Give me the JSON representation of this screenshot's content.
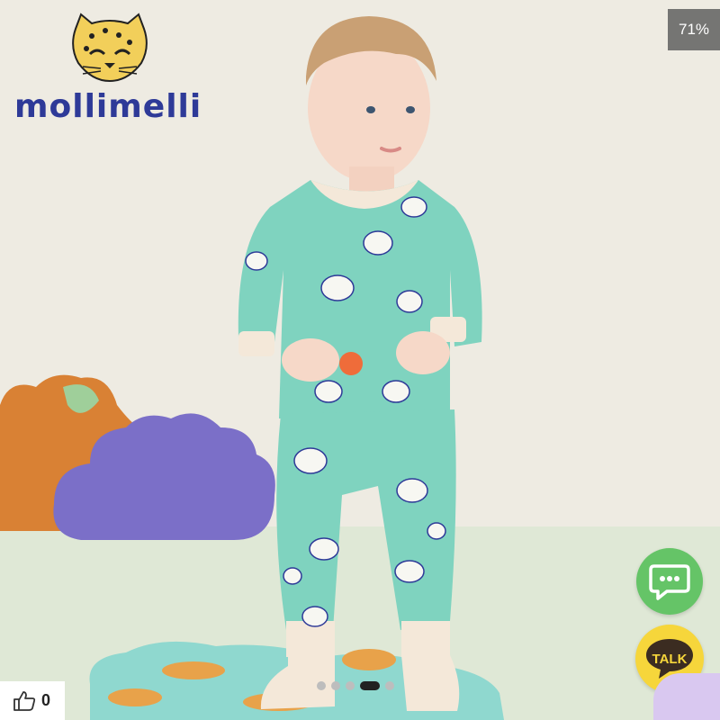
{
  "brand": {
    "name": "mollimelli",
    "logo_icon": "leopard-icon"
  },
  "gallery": {
    "counter": "71%",
    "active_index": 3,
    "dot_count": 5
  },
  "actions": {
    "chat_icon": "chat-bubble-icon",
    "talk_label": "TALK"
  },
  "likes": {
    "count": "0",
    "icon": "thumbs-up-icon"
  },
  "colors": {
    "chat": "#65c467",
    "talk": "#f6d63b",
    "brand": "#2e3a98",
    "garment": "#7fd3bf"
  }
}
